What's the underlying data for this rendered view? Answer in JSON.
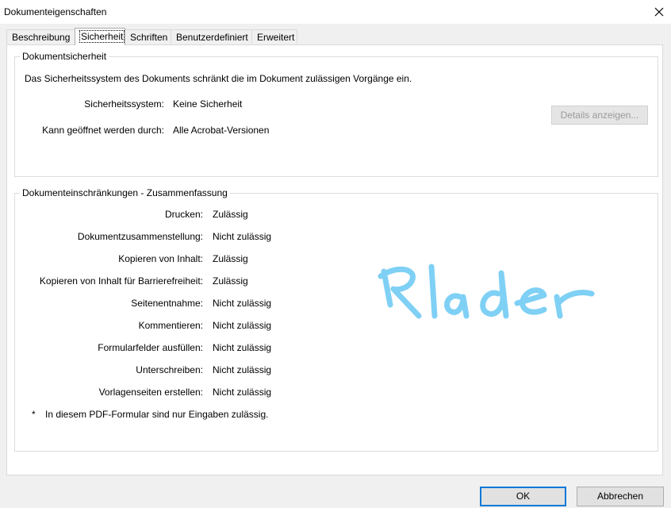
{
  "window": {
    "title": "Dokumenteigenschaften",
    "close_icon": "close-icon"
  },
  "tabs": [
    {
      "label": "Beschreibung",
      "active": false
    },
    {
      "label": "Sicherheit",
      "active": true
    },
    {
      "label": "Schriften",
      "active": false
    },
    {
      "label": "Benutzerdefiniert",
      "active": false
    },
    {
      "label": "Erweitert",
      "active": false
    }
  ],
  "security": {
    "legend": "Dokumentsicherheit",
    "description": "Das Sicherheitssystem des Dokuments schränkt die im Dokument zulässigen Vorgänge ein.",
    "system_label": "Sicherheitssystem:",
    "system_value": "Keine Sicherheit",
    "opened_by_label": "Kann geöffnet werden durch:",
    "opened_by_value": "Alle Acrobat-Versionen",
    "details_button": "Details anzeigen..."
  },
  "restrictions": {
    "legend": "Dokumenteinschränkungen - Zusammenfassung",
    "items": [
      {
        "label": "Drucken:",
        "value": "Zulässig"
      },
      {
        "label": "Dokumentzusammenstellung:",
        "value": "Nicht zulässig"
      },
      {
        "label": "Kopieren von Inhalt:",
        "value": "Zulässig"
      },
      {
        "label": "Kopieren von Inhalt für Barrierefreiheit:",
        "value": "Zulässig"
      },
      {
        "label": "Seitenentnahme:",
        "value": "Nicht zulässig"
      },
      {
        "label": "Kommentieren:",
        "value": "Nicht zulässig"
      },
      {
        "label": "Formularfelder ausfüllen:",
        "value": "Nicht zulässig"
      },
      {
        "label": "Unterschreiben:",
        "value": "Nicht zulässig"
      },
      {
        "label": "Vorlagenseiten erstellen:",
        "value": "Nicht zulässig"
      }
    ],
    "note_marker": "*",
    "note": "In diesem PDF-Formular sind nur Eingaben zulässig."
  },
  "annotation": {
    "text": "Reader",
    "color": "#7fd0f5"
  },
  "footer": {
    "ok_label": "OK",
    "cancel_label": "Abbrechen"
  },
  "colors": {
    "accent": "#0078d7"
  }
}
